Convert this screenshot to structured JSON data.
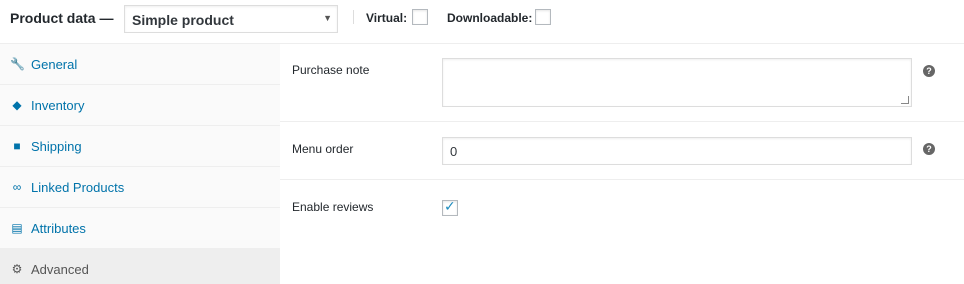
{
  "header": {
    "title": "Product data —",
    "product_type": {
      "selected": "Simple product",
      "caret": "▼"
    },
    "options": [
      {
        "label": "Virtual:",
        "checked": false
      },
      {
        "label": "Downloadable:",
        "checked": false
      }
    ]
  },
  "tabs": [
    {
      "label": "General",
      "icon": "wrench-icon",
      "glyph": "🔧",
      "active": false
    },
    {
      "label": "Inventory",
      "icon": "tag-icon",
      "glyph": "◆",
      "active": false
    },
    {
      "label": "Shipping",
      "icon": "truck-icon",
      "glyph": "■",
      "active": false
    },
    {
      "label": "Linked Products",
      "icon": "link-icon",
      "glyph": "∞",
      "active": false
    },
    {
      "label": "Attributes",
      "icon": "list-icon",
      "glyph": "▤",
      "active": false
    },
    {
      "label": "Advanced",
      "icon": "gear-icon",
      "glyph": "⚙",
      "active": true
    }
  ],
  "fields": {
    "purchase_note": {
      "label": "Purchase note",
      "value": "",
      "help": "?"
    },
    "menu_order": {
      "label": "Menu order",
      "value": "0",
      "help": "?"
    },
    "enable_reviews": {
      "label": "Enable reviews",
      "checked": true,
      "tick": "✓"
    }
  },
  "colors": {
    "link": "#0073aa",
    "checkmark": "#1e8cbe",
    "sidebar_bg": "#fafafa",
    "active_tab_bg": "#eeeeee"
  }
}
